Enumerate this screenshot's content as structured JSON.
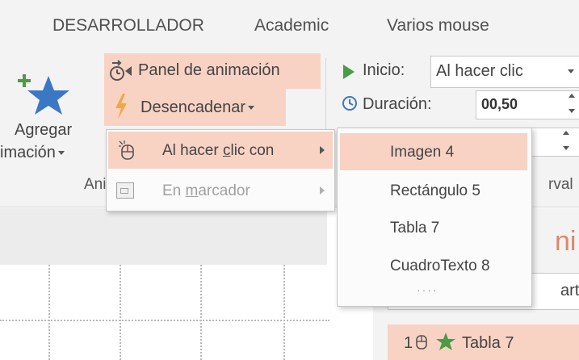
{
  "tabs": [
    "DESARROLLADOR",
    "Academic",
    "Varios mouse"
  ],
  "ribbon": {
    "add_animation": {
      "line1": "Agregar",
      "line2": "imación"
    },
    "animation_panel": "Panel de animación",
    "trigger": "Desencadenar",
    "start_label": "Inicio:",
    "start_value": "Al hacer clic",
    "duration_label": "Duración:",
    "duration_value": "00,50",
    "group_label_fragment": "Anir",
    "right_fragment": "rval"
  },
  "trigger_menu": {
    "items": [
      {
        "label_pre": "Al hacer ",
        "label_key": "c",
        "label_post": "lic con",
        "enabled": true,
        "highlighted": true
      },
      {
        "label_pre": "En ",
        "label_key": "m",
        "label_post": "arcador",
        "enabled": false,
        "highlighted": false
      }
    ]
  },
  "objects_menu": {
    "items": [
      "Imagen 4",
      "Rectángulo 5",
      "Tabla 7",
      "CuadroTexto 8"
    ],
    "selected_index": 0,
    "more": "····"
  },
  "pane": {
    "title_fragment": "ni",
    "button_fragment": "art",
    "entry_number": "1",
    "entry_label": "Tabla 7"
  },
  "colors": {
    "highlight": "#f8d3c4",
    "star": "#3a78c4",
    "green": "#4a9c45",
    "orange": "#f08a24"
  },
  "icons": [
    "add-animation-star-icon",
    "animation-panel-icon",
    "lightning-icon",
    "play-icon",
    "clock-icon",
    "mouse-click-icon",
    "bookmark-icon",
    "star-icon"
  ]
}
